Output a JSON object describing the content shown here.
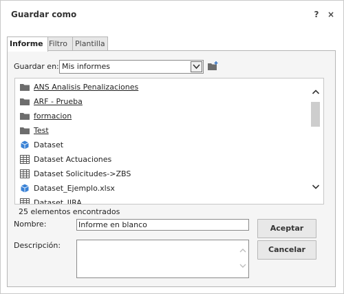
{
  "dialog": {
    "title": "Guardar como",
    "help_label": "?",
    "close_label": "×"
  },
  "tabs": [
    {
      "label": "Informe"
    },
    {
      "label": "Filtro"
    },
    {
      "label": "Plantilla"
    }
  ],
  "location": {
    "label": "Guardar en:",
    "value": "Mis informes"
  },
  "files": [
    {
      "name": "ANS Analisis Penalizaciones",
      "icon": "folder-icon"
    },
    {
      "name": "ARF - Prueba",
      "icon": "folder-icon"
    },
    {
      "name": "formacion",
      "icon": "folder-icon"
    },
    {
      "name": "Test",
      "icon": "folder-icon"
    },
    {
      "name": "Dataset",
      "icon": "cube-icon"
    },
    {
      "name": "Dataset Actuaciones",
      "icon": "table-icon"
    },
    {
      "name": "Dataset Solicitudes->ZBS",
      "icon": "table-icon"
    },
    {
      "name": "Dataset_Ejemplo.xlsx",
      "icon": "cube-icon"
    },
    {
      "name": "Dataset_JIRA",
      "icon": "table-icon"
    }
  ],
  "count_text": "25 elementos encontrados",
  "form": {
    "name_label": "Nombre:",
    "name_value": "Informe en blanco",
    "desc_label": "Descripción:",
    "desc_value": ""
  },
  "buttons": {
    "accept": "Aceptar",
    "cancel": "Cancelar"
  },
  "colors": {
    "folder": "#6d6d6d",
    "cube": "#3a82d6",
    "table": "#555555"
  }
}
